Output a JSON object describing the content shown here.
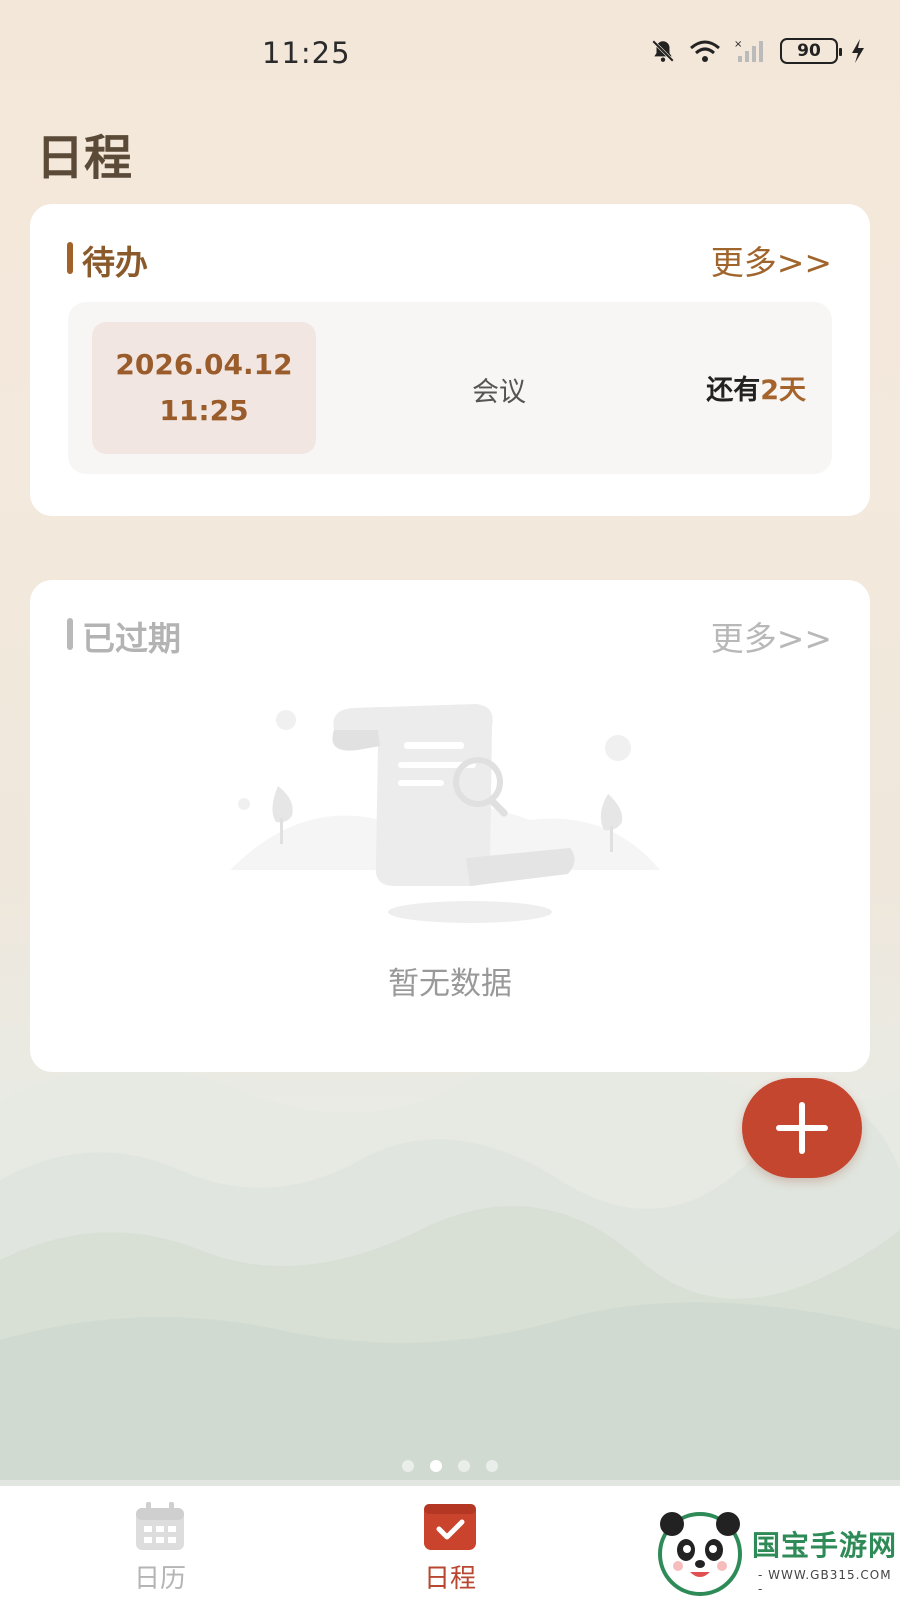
{
  "status_bar": {
    "time": "11:25",
    "battery_level": "90",
    "icons": [
      "bell-muted-icon",
      "wifi-icon",
      "signal-icon",
      "battery-icon",
      "charging-icon"
    ]
  },
  "page": {
    "title": "日程"
  },
  "todo_section": {
    "title": "待办",
    "more_label": "更多>>",
    "items": [
      {
        "date": "2026.04.12",
        "time": "11:25",
        "name": "会议",
        "countdown_prefix": "还有",
        "countdown_value": "2",
        "countdown_unit": "天"
      }
    ]
  },
  "expired_section": {
    "title": "已过期",
    "more_label": "更多>>",
    "empty_text": "暂无数据"
  },
  "fab": {
    "icon": "plus-icon"
  },
  "bottom_nav": {
    "items": [
      {
        "label": "日历",
        "icon": "calendar-icon",
        "active": false
      },
      {
        "label": "日程",
        "icon": "schedule-check-icon",
        "active": true
      }
    ]
  },
  "watermark": {
    "text": "国宝手游网",
    "url": "- WWW.GB315.COM -"
  },
  "colors": {
    "accent": "#c5462f",
    "brown": "#a0612b",
    "title": "#5b4a38"
  }
}
